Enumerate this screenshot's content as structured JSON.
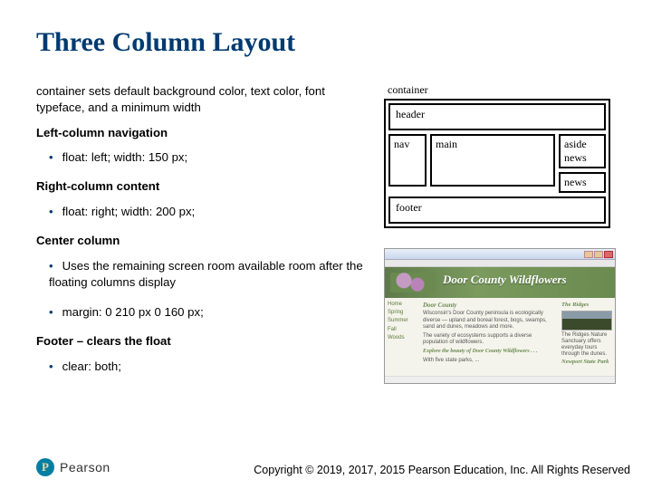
{
  "title": "Three Column Layout",
  "intro": "container sets default background color, text color, font typeface, and a minimum width",
  "sections": {
    "leftNav": {
      "heading": "Left-column navigation",
      "bullet": "float: left; width: 150 px;"
    },
    "rightCol": {
      "heading": "Right-column content",
      "bullet": "float: right; width: 200 px;"
    },
    "center": {
      "heading": "Center column",
      "bullet1": "Uses the remaining screen room available room after the floating columns display",
      "bullet2": "margin: 0 210 px 0 160 px;"
    },
    "footer": {
      "heading": "Footer – clears the float",
      "bullet": "clear: both;"
    }
  },
  "wireframe": {
    "container": "container",
    "header": "header",
    "nav": "nav",
    "main": "main",
    "aside": "aside",
    "news1": "news",
    "news2": "news",
    "footer": "footer"
  },
  "screenshot": {
    "bannerTitle": "Door County Wildflowers",
    "bannerSub": "",
    "nav": [
      "Home",
      "Spring",
      "Summer",
      "Fall",
      "Woods"
    ],
    "mainH": "Door County",
    "mainP1": "Wisconsin's Door County peninsula is ecologically diverse — upland and boreal forest, bogs, swamps, sand and dunes, meadows and more.",
    "mainP2": "The variety of ecosystems supports a diverse population of wildflowers.",
    "mainH2": "Explore the beauty of Door County Wildflowers . . .",
    "mainList": "With five state parks, ...",
    "asideH1": "The Ridges",
    "asideP1": "The Ridges Nature Sanctuary offers everyday tours through the dunes.",
    "asideH2": "Newport State Park"
  },
  "brand": {
    "name": "Pearson",
    "copyright": "Copyright © 2019, 2017, 2015 Pearson Education, Inc. All Rights Reserved"
  }
}
